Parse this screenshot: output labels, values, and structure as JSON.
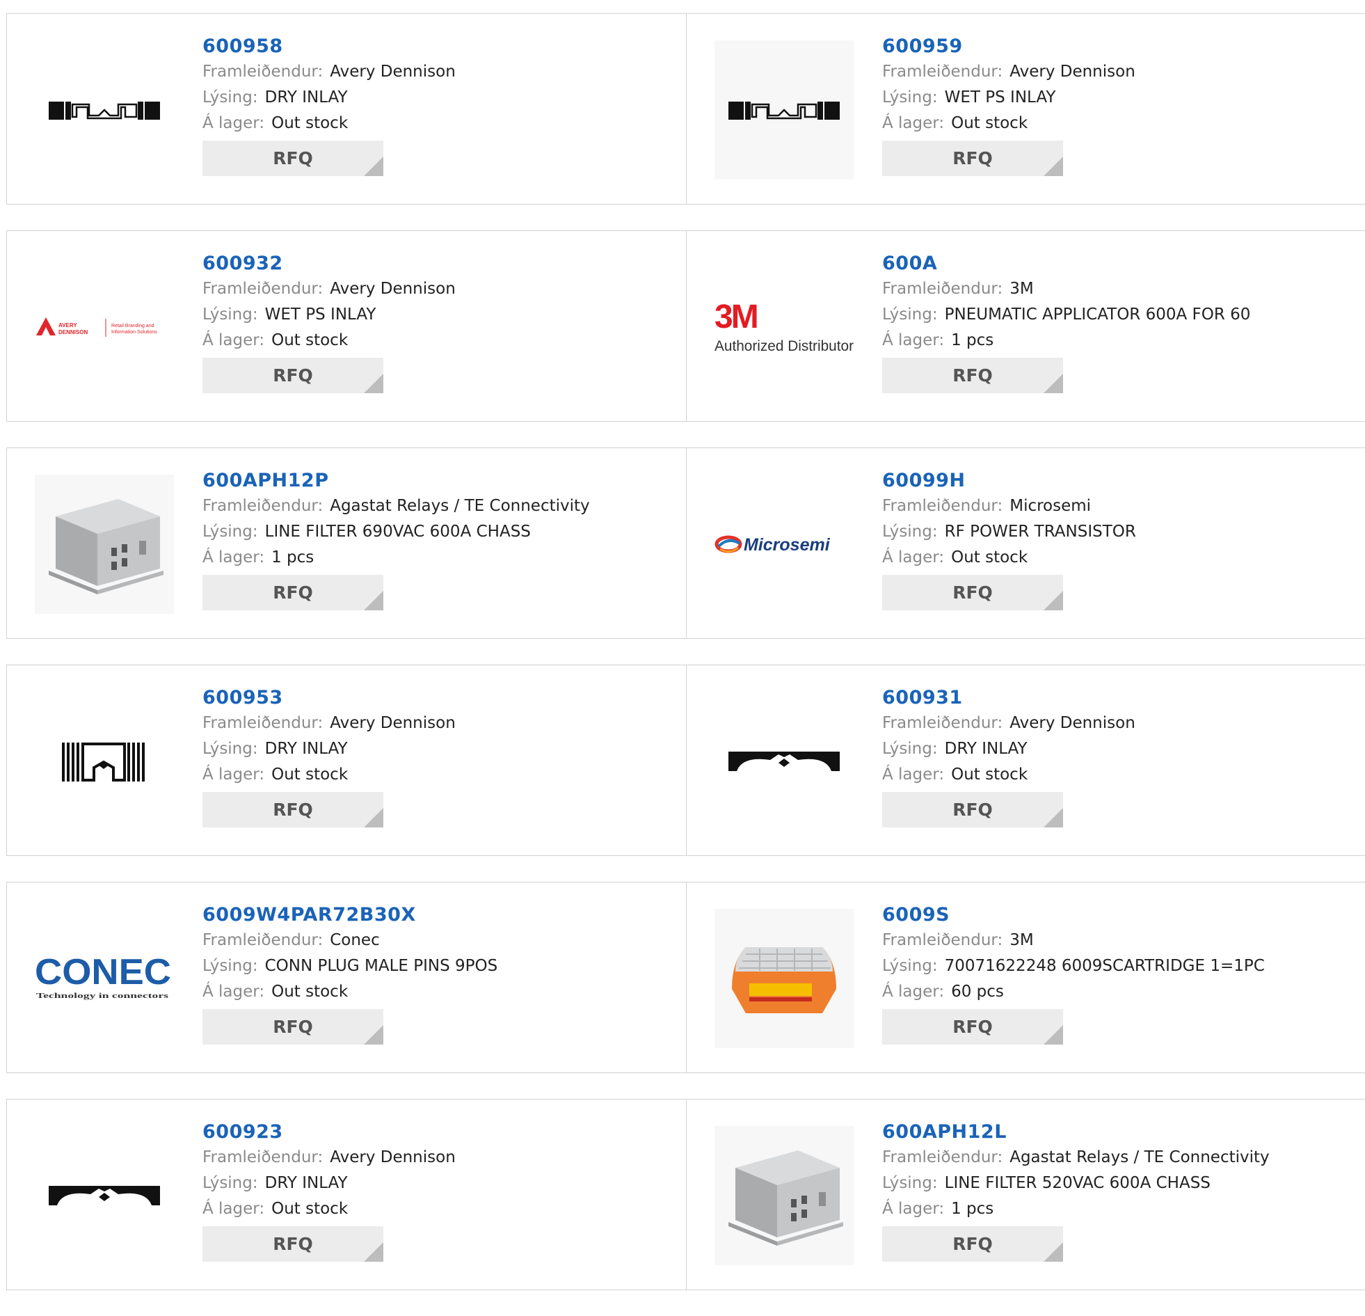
{
  "labels": {
    "manufacturer": "Framleiðendur:",
    "description": "Lýsing:",
    "stock": "Á lager:",
    "rfq": "RFQ"
  },
  "products": [
    {
      "pn": "600958",
      "manufacturer": "Avery Dennison",
      "description": "DRY INLAY",
      "stock": "Out stock",
      "image": "rfid-inlay-horizontal"
    },
    {
      "pn": "600959",
      "manufacturer": "Avery Dennison",
      "description": "WET PS INLAY",
      "stock": "Out stock",
      "image": "rfid-inlay-horizontal"
    },
    {
      "pn": "600932",
      "manufacturer": "Avery Dennison",
      "description": "WET PS INLAY",
      "stock": "Out stock",
      "image": "avery-dennison-logo",
      "logo_text": [
        "AVERY",
        "DENNISON",
        "Retail Branding and",
        "Information Solutions"
      ]
    },
    {
      "pn": "600A",
      "manufacturer": "3M",
      "description": "PNEUMATIC APPLICATOR 600A FOR 60",
      "stock": "1 pcs",
      "image": "3m-logo",
      "logo_text": [
        "3M",
        "Authorized Distributor"
      ]
    },
    {
      "pn": "600APH12P",
      "manufacturer": "Agastat Relays / TE Connectivity",
      "description": "LINE FILTER 690VAC 600A CHASS",
      "stock": "1 pcs",
      "image": "line-filter-photo"
    },
    {
      "pn": "60099H",
      "manufacturer": "Microsemi",
      "description": "RF POWER TRANSISTOR",
      "stock": "Out stock",
      "image": "microsemi-logo",
      "logo_text": [
        "Microsemi"
      ]
    },
    {
      "pn": "600953",
      "manufacturer": "Avery Dennison",
      "description": "DRY INLAY",
      "stock": "Out stock",
      "image": "rfid-inlay-square"
    },
    {
      "pn": "600931",
      "manufacturer": "Avery Dennison",
      "description": "DRY INLAY",
      "stock": "Out stock",
      "image": "rfid-inlay-arch"
    },
    {
      "pn": "6009W4PAR72B30X",
      "manufacturer": "Conec",
      "description": "CONN PLUG MALE PINS 9POS",
      "stock": "Out stock",
      "image": "conec-logo",
      "logo_text": [
        "CONEC",
        "Technology in connectors"
      ]
    },
    {
      "pn": "6009S",
      "manufacturer": "3M",
      "description": "70071622248 6009SCARTRIDGE 1=1PC",
      "stock": "60 pcs",
      "image": "cartridge-photo"
    },
    {
      "pn": "600923",
      "manufacturer": "Avery Dennison",
      "description": "DRY INLAY",
      "stock": "Out stock",
      "image": "rfid-inlay-arch"
    },
    {
      "pn": "600APH12L",
      "manufacturer": "Agastat Relays / TE Connectivity",
      "description": "LINE FILTER 520VAC 600A CHASS",
      "stock": "1 pcs",
      "image": "line-filter-photo"
    }
  ],
  "colors": {
    "link": "#1a63b8",
    "border": "#d2d2d2",
    "button": "#ececec",
    "avery_red": "#e0252b",
    "conec_blue": "#1d5ca8",
    "threem_red": "#e31b23"
  }
}
